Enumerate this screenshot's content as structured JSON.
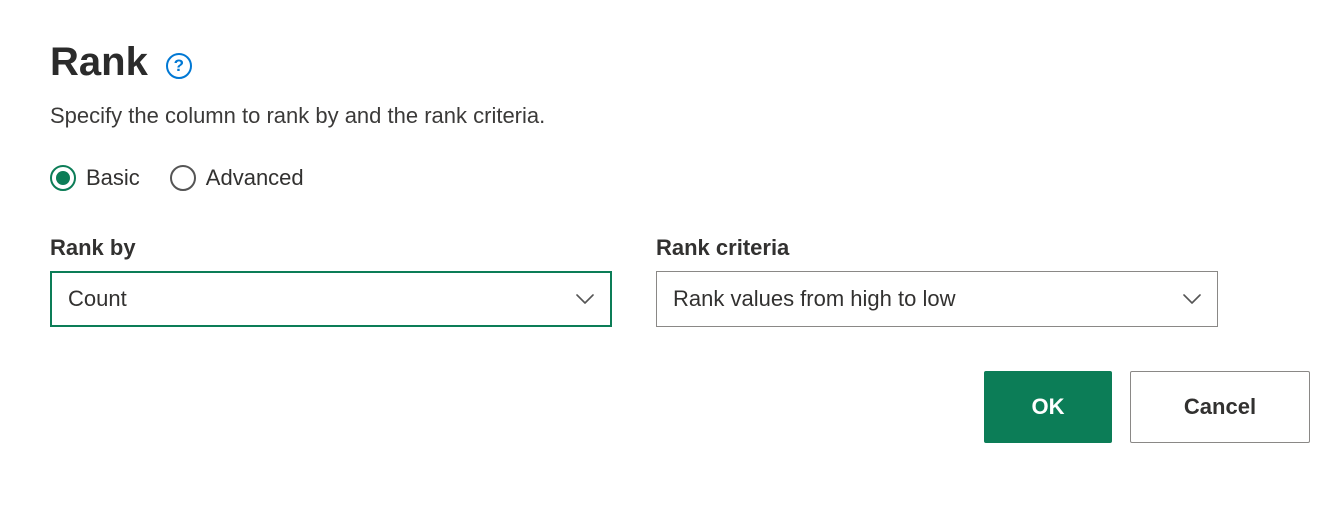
{
  "dialog": {
    "title": "Rank",
    "help_icon": "?",
    "description": "Specify the column to rank by and the rank criteria."
  },
  "mode": {
    "basic_label": "Basic",
    "advanced_label": "Advanced",
    "selected": "basic"
  },
  "fields": {
    "rank_by": {
      "label": "Rank by",
      "value": "Count"
    },
    "rank_criteria": {
      "label": "Rank criteria",
      "value": "Rank values from high to low"
    }
  },
  "buttons": {
    "ok": "OK",
    "cancel": "Cancel"
  },
  "colors": {
    "accent": "#0c7d57",
    "help": "#0078d4"
  }
}
